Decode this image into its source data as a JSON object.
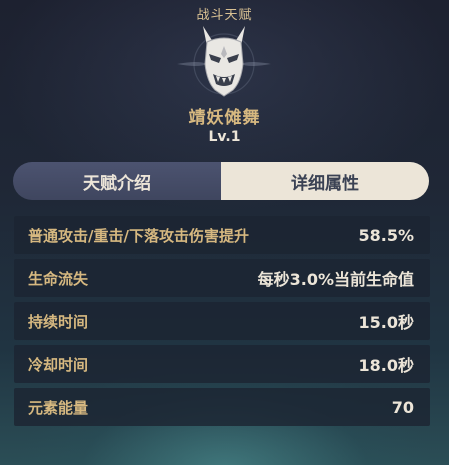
{
  "header": {
    "label": "战斗天赋"
  },
  "talent": {
    "icon": "oni-mask-icon",
    "name": "靖妖傩舞",
    "level": "Lv.1"
  },
  "tabs": [
    {
      "label": "天赋介绍",
      "active": false
    },
    {
      "label": "详细属性",
      "active": true
    }
  ],
  "stats": [
    {
      "name": "普通攻击/重击/下落攻击伤害提升",
      "value": "58.5%"
    },
    {
      "name": "生命流失",
      "value": "每秒3.0%当前生命值"
    },
    {
      "name": "持续时间",
      "value": "15.0秒"
    },
    {
      "name": "冷却时间",
      "value": "18.0秒"
    },
    {
      "name": "元素能量",
      "value": "70"
    }
  ],
  "colors": {
    "gold_text": "#d6b880",
    "light_text": "#ece5d8",
    "tab_inactive": "#4c5370",
    "tab_active": "#ece5d8"
  }
}
